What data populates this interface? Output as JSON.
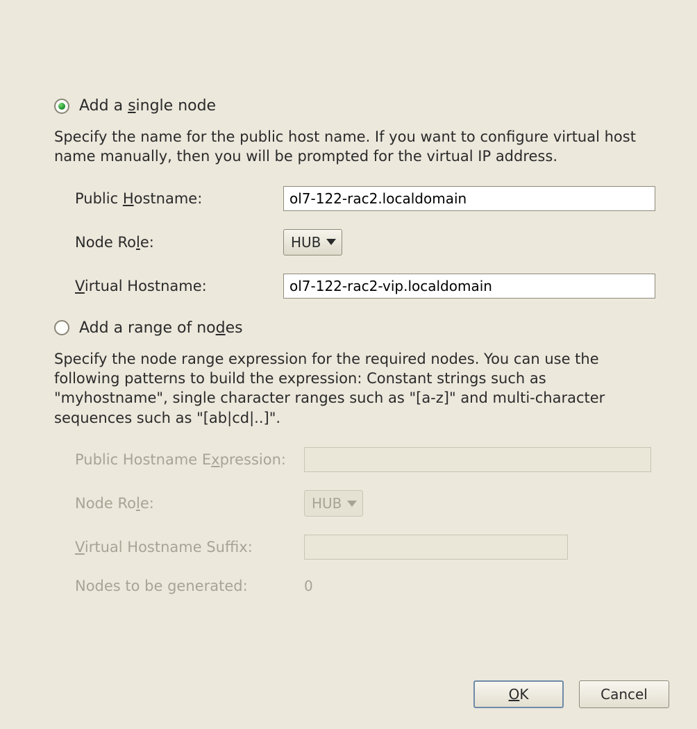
{
  "radio": {
    "single_label_pre": "Add a ",
    "single_label_mnemonic": "s",
    "single_label_post": "ingle node",
    "range_label_pre": "Add a range of no",
    "range_label_mnemonic": "d",
    "range_label_post": "es",
    "selected": "single"
  },
  "single": {
    "description": "Specify the name for the public host name. If you want to configure virtual host name manually, then you will be prompted for the virtual IP address.",
    "public_hostname_label_pre": "Public ",
    "public_hostname_label_mnemonic": "H",
    "public_hostname_label_post": "ostname:",
    "public_hostname_value": "ol7-122-rac2.localdomain",
    "node_role_label_pre": "Node Ro",
    "node_role_label_mnemonic": "l",
    "node_role_label_post": "e:",
    "node_role_value": "HUB",
    "virtual_hostname_label_mnemonic": "V",
    "virtual_hostname_label_post": "irtual Hostname:",
    "virtual_hostname_value": "ol7-122-rac2-vip.localdomain"
  },
  "range": {
    "description": "Specify the node range expression for the required nodes. You can use the following patterns to build the expression: Constant strings such as \"myhostname\", single character ranges such as \"[a-z]\" and multi-character sequences such as \"[ab|cd|..]\".",
    "public_expr_label_pre": "Public Hostname E",
    "public_expr_label_mnemonic": "x",
    "public_expr_label_post": "pression:",
    "public_expr_value": "",
    "node_role_label_pre": "Node Ro",
    "node_role_label_mnemonic": "l",
    "node_role_label_post": "e:",
    "node_role_value": "HUB",
    "virtual_suffix_label_mnemonic": "V",
    "virtual_suffix_label_post": "irtual Hostname Suffix:",
    "virtual_suffix_value": "",
    "nodes_generated_label": "Nodes to be generated:",
    "nodes_generated_value": "0"
  },
  "buttons": {
    "ok_mnemonic": "O",
    "ok_post": "K",
    "cancel": "Cancel"
  }
}
